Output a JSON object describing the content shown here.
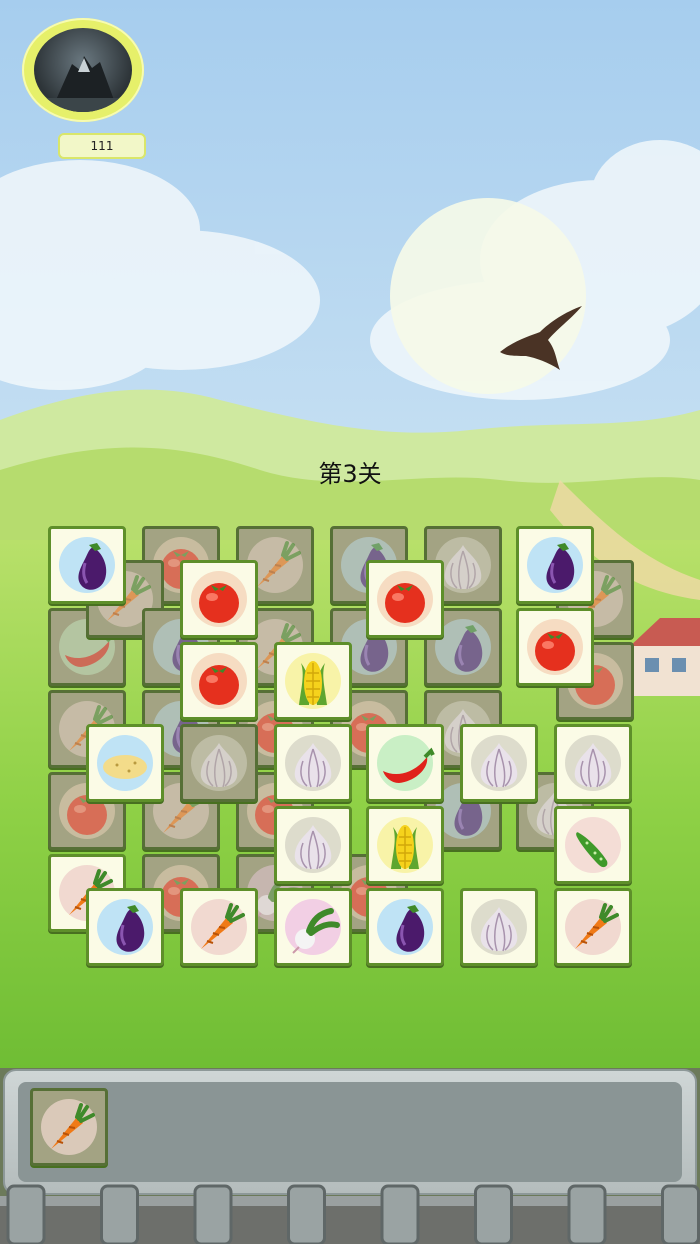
{
  "player": {
    "score": "111",
    "avatar": "mountain-avatar"
  },
  "level_title": "第3关",
  "background": {
    "sky": "#a9d0ef",
    "hills": "#b9dd6a",
    "grass": "#7ec63a"
  },
  "tile_colors": {
    "face": "#fbfbe6",
    "border": "#5e8f2a",
    "blocked_face": "#a3a383"
  },
  "disc_colors": {
    "eggplant": "#bfe3f5",
    "tomato": "#f6dcc2",
    "carrot": "#f1d9d0",
    "garlic": "#dddccc",
    "corn": "#f8f3a8",
    "chili": "#c9efc5",
    "cucumber": "#f4ddd6",
    "radish": "#f2cfe4",
    "potato": "#bfe3f5"
  },
  "tiles": [
    {
      "icon": "tomato",
      "blocked": true
    },
    {
      "icon": "carrot",
      "blocked": true
    },
    {
      "icon": "eggplant",
      "blocked": true
    },
    {
      "icon": "garlic",
      "blocked": true
    },
    {
      "icon": "chili",
      "blocked": true
    },
    {
      "icon": "carrot",
      "blocked": true
    },
    {
      "icon": "eggplant",
      "blocked": true
    },
    {
      "icon": "carrot",
      "blocked": true
    },
    {
      "icon": "tomato",
      "blocked": true
    },
    {
      "icon": "eggplant",
      "blocked": true
    },
    {
      "icon": "carrot",
      "blocked": true
    },
    {
      "icon": "tomato",
      "blocked": true
    },
    {
      "icon": "eggplant",
      "blocked": true
    },
    {
      "icon": "carrot",
      "blocked": true
    },
    {
      "icon": "tomato",
      "blocked": true
    },
    {
      "icon": "eggplant",
      "blocked": true
    },
    {
      "icon": "garlic",
      "blocked": true
    },
    {
      "icon": "tomato",
      "blocked": true
    },
    {
      "icon": "radish",
      "blocked": true
    },
    {
      "icon": "tomato",
      "blocked": true
    },
    {
      "icon": "eggplant",
      "blocked": true
    },
    {
      "icon": "garlic",
      "blocked": true
    },
    {
      "icon": "tomato",
      "blocked": true
    },
    {
      "icon": "carrot",
      "blocked": true
    },
    {
      "icon": "tomato",
      "blocked": true
    },
    {
      "icon": "eggplant",
      "blocked": false
    },
    {
      "icon": "garlic",
      "blocked": true
    },
    {
      "icon": "eggplant",
      "blocked": false
    },
    {
      "icon": "tomato",
      "blocked": false
    },
    {
      "icon": "tomato",
      "blocked": false
    },
    {
      "icon": "tomato",
      "blocked": false
    },
    {
      "icon": "tomato",
      "blocked": false
    },
    {
      "icon": "corn",
      "blocked": false
    },
    {
      "icon": "potato",
      "blocked": false
    },
    {
      "icon": "garlic",
      "blocked": false
    },
    {
      "icon": "chili",
      "blocked": false
    },
    {
      "icon": "garlic",
      "blocked": false
    },
    {
      "icon": "garlic",
      "blocked": false
    },
    {
      "icon": "garlic",
      "blocked": false
    },
    {
      "icon": "corn",
      "blocked": false
    },
    {
      "icon": "cucumber",
      "blocked": false
    },
    {
      "icon": "carrot",
      "blocked": false
    },
    {
      "icon": "eggplant",
      "blocked": false
    },
    {
      "icon": "carrot",
      "blocked": false
    },
    {
      "icon": "radish",
      "blocked": false
    },
    {
      "icon": "eggplant",
      "blocked": false
    },
    {
      "icon": "garlic",
      "blocked": false
    },
    {
      "icon": "carrot",
      "blocked": false
    }
  ],
  "tray": {
    "slots": [
      {
        "icon": "carrot"
      }
    ],
    "fence_posts": 8
  }
}
